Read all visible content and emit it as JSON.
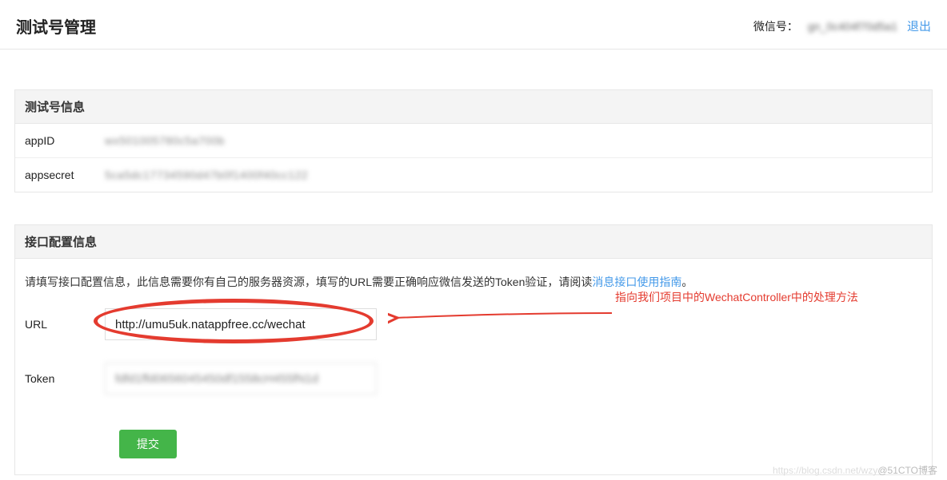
{
  "header": {
    "title": "测试号管理",
    "wechat_label": "微信号：",
    "wechat_id": "gn_0c404f70d5a1",
    "logout": "退出"
  },
  "section_info": {
    "title": "测试号信息",
    "appid_label": "appID",
    "appid_value": "wx501005780c5a700b",
    "appsecret_label": "appsecret",
    "appsecret_value": "5ca5dc17734590d47b0f1400f40cc122"
  },
  "section_api": {
    "title": "接口配置信息",
    "desc_pre": "请填写接口配置信息，此信息需要你有自己的服务器资源，填写的URL需要正确响应微信发送的Token验证，请阅读",
    "guide_link": "消息接口使用指南",
    "desc_post": "。",
    "url_label": "URL",
    "url_value": "http://umu5uk.natappfree.cc/wechat",
    "token_label": "Token",
    "token_value": "fdfd1ffd0656045450df1558cH455fN1d",
    "submit": "提交",
    "annotation": "指向我们项目中的WechatController中的处理方法"
  },
  "watermark": {
    "faded": "https://blog.csdn.net/wzy",
    "text": "@51CTO博客"
  }
}
